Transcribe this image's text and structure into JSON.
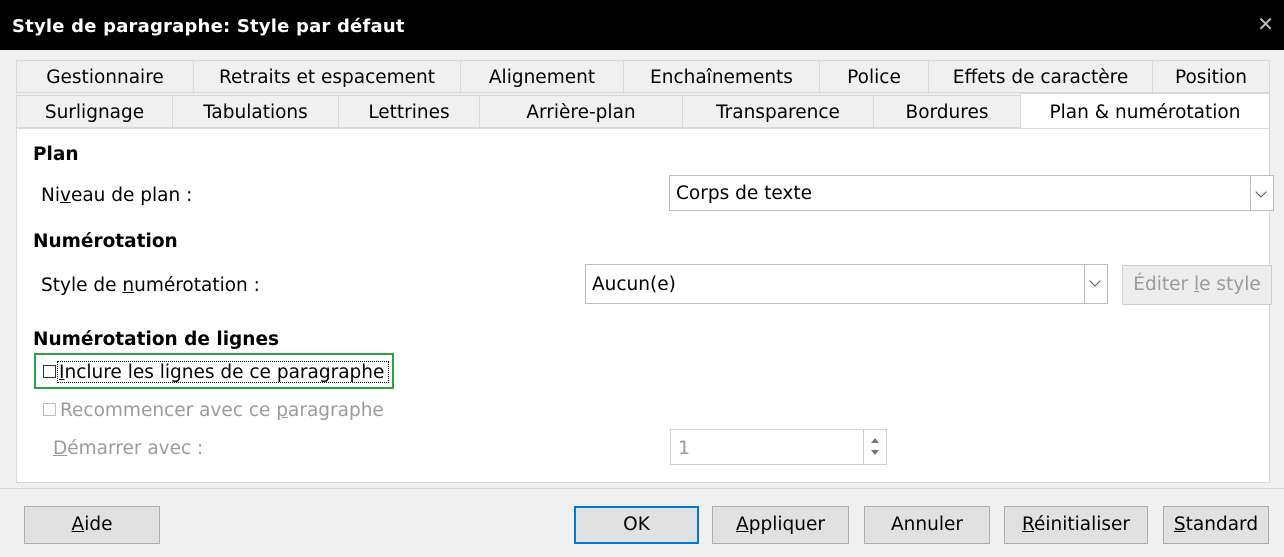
{
  "window": {
    "title": "Style de paragraphe: Style par défaut",
    "close_glyph": "✕"
  },
  "tabs": {
    "row1": [
      "Gestionnaire",
      "Retraits et espacement",
      "Alignement",
      "Enchaînements",
      "Police",
      "Effets de caractère",
      "Position"
    ],
    "row2": [
      "Surlignage",
      "Tabulations",
      "Lettrines",
      "Arrière-plan",
      "Transparence",
      "Bordures",
      "Plan & numérotation"
    ],
    "active": "Plan & numérotation"
  },
  "plan": {
    "heading": "Plan",
    "level_label_pre": "Ni",
    "level_label_u": "v",
    "level_label_post": "eau de plan :",
    "level_value": "Corps de texte"
  },
  "numbering": {
    "heading": "Numérotation",
    "style_label_pre": "Style de ",
    "style_label_u": "n",
    "style_label_post": "umérotation :",
    "style_value": "Aucun(e)",
    "edit_pre": "Éditer ",
    "edit_u": "l",
    "edit_post": "e style"
  },
  "line_numbering": {
    "heading": "Numérotation de lignes",
    "include_u": "I",
    "include_post": "nclure les lignes de ce paragraphe",
    "restart_pre": "Recommencer avec ce ",
    "restart_u": "p",
    "restart_post": "aragraphe",
    "start_u": "D",
    "start_post": "émarrer avec :",
    "start_value": "1"
  },
  "buttons": {
    "help_u": "A",
    "help_post": "ide",
    "ok": "OK",
    "apply_u": "A",
    "apply_post": "ppliquer",
    "cancel": "Annuler",
    "reset_u": "R",
    "reset_post": "éinitialiser",
    "standard_u": "S",
    "standard_post": "tandard"
  },
  "colors": {
    "focus": "#2ea043",
    "default_button_border": "#0078d7",
    "titlebar": "#000000"
  }
}
